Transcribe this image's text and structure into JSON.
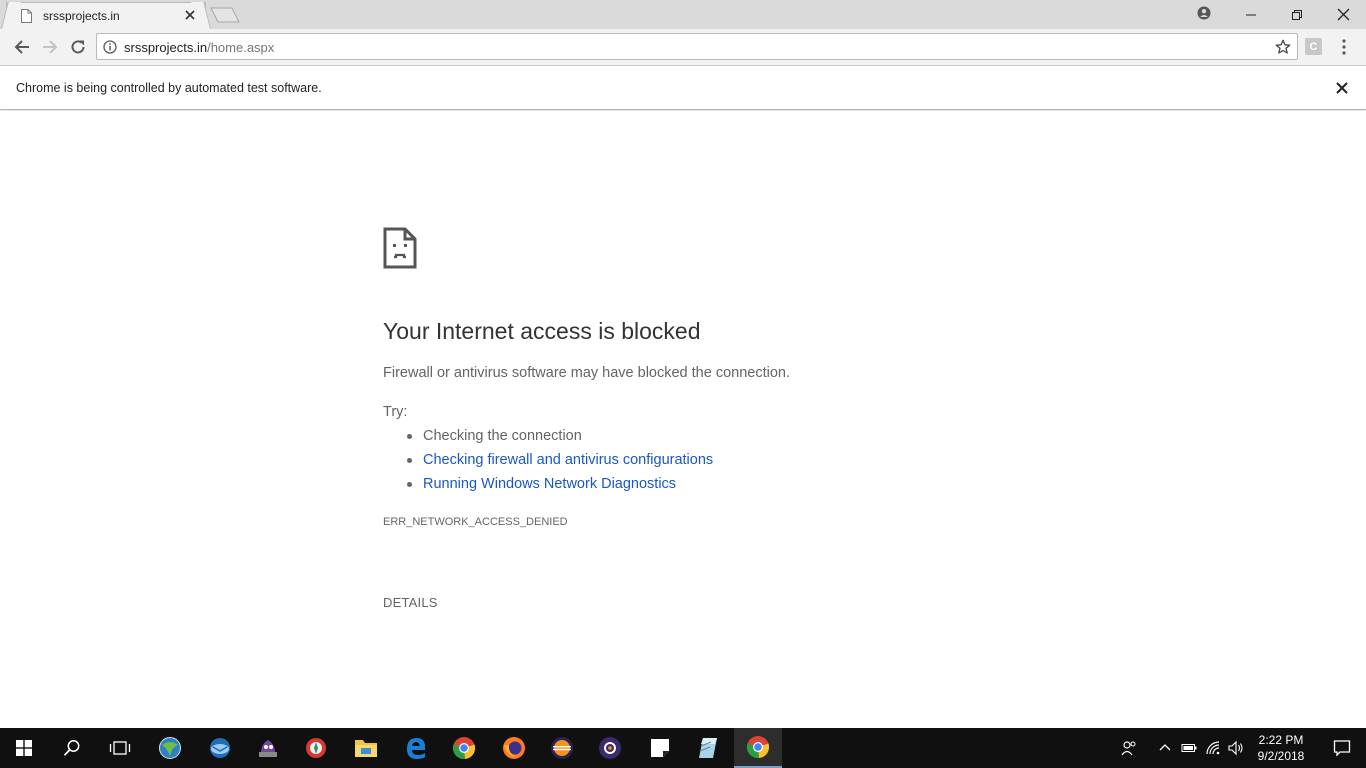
{
  "browser": {
    "tab": {
      "title": "srssprojects.in",
      "favicon": "page-icon"
    },
    "address_bar": {
      "host": "srssprojects.in",
      "path": "/home.aspx"
    },
    "extension_label": "C",
    "infobar": {
      "text": "Chrome is being controlled by automated test software."
    }
  },
  "error_page": {
    "title": "Your Internet access is blocked",
    "description": "Firewall or antivirus software may have blocked the connection.",
    "try_label": "Try:",
    "suggestions": [
      {
        "text": "Checking the connection",
        "is_link": false
      },
      {
        "text": "Checking firewall and antivirus configurations",
        "is_link": true
      },
      {
        "text": "Running Windows Network Diagnostics",
        "is_link": true
      }
    ],
    "error_code": "ERR_NETWORK_ACCESS_DENIED",
    "details_label": "DETAILS"
  },
  "taskbar": {
    "apps": [
      "start-icon",
      "search-icon",
      "task-view-icon",
      "network-app-icon",
      "mail-app-icon",
      "purple-app-icon",
      "pinwheel-app-icon",
      "file-explorer-icon",
      "edge-icon",
      "chrome-icon",
      "firefox-icon",
      "eclipse-icon",
      "purple-gear-app-icon",
      "sticky-notes-icon",
      "blue-app-icon",
      "chrome-active-icon"
    ],
    "clock": {
      "time": "2:22 PM",
      "date": "9/2/2018"
    }
  },
  "colors": {
    "link": "#1a57c4",
    "text_muted": "#646464",
    "taskbar": "#101010"
  }
}
